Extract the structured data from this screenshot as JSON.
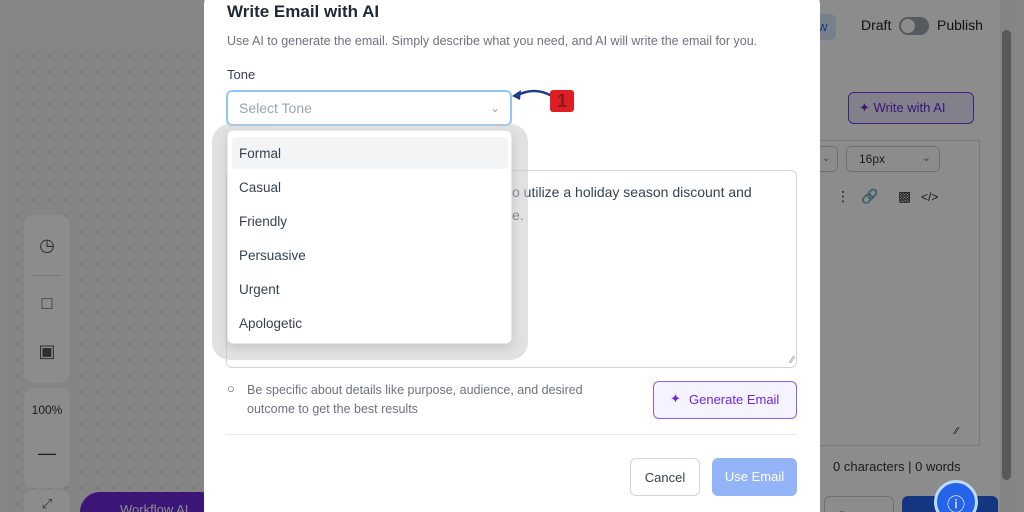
{
  "background": {
    "header": {
      "view_fragment": "w",
      "draft_label": "Draft",
      "publish_label": "Publish"
    },
    "editor": {
      "write_with_ai_label": "Write with AI",
      "font_size": "16px",
      "char_count": "0 characters | 0 words",
      "cancel_fragment": "C"
    },
    "canvas": {
      "zoom": "100%",
      "zoom_out": "—",
      "workflow_label": "Workflow AI"
    }
  },
  "modal": {
    "title": "Write Email with AI",
    "subtitle": "Use AI to generate the email. Simply describe what you need, and AI will write the email for you.",
    "tone_label": "Tone",
    "tone_placeholder": "Select Tone",
    "tone_options": [
      "Formal",
      "Casual",
      "Friendly",
      "Persuasive",
      "Urgent",
      "Apologetic"
    ],
    "prompt_visible_line1": "o utilize a holiday season discount and",
    "prompt_visible_line2": "e.",
    "tip": "Be specific about details like purpose, audience, and desired outcome to get the best results",
    "generate_label": "Generate Email",
    "cancel_label": "Cancel",
    "use_label": "Use Email"
  },
  "annotation": {
    "step": "1"
  },
  "colors": {
    "accent_purple": "#7c3aed",
    "primary_blue": "#2563eb",
    "use_btn_disabled": "#93b4f6",
    "focus_ring": "#93c5fd",
    "annotation_red": "#e11d24"
  }
}
